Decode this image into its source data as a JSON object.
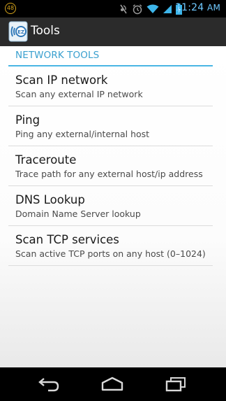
{
  "status_bar": {
    "notification_count": "48",
    "time": "11:24",
    "ampm": "AM",
    "clock_color": "#6fc9ff"
  },
  "action_bar": {
    "title": "Tools",
    "icon": "network-tools-app-icon"
  },
  "section": {
    "header": "NETWORK TOOLS",
    "accent_color": "#4ab6e4"
  },
  "items": [
    {
      "title": "Scan IP network",
      "subtitle": "Scan any external IP network"
    },
    {
      "title": "Ping",
      "subtitle": "Ping any external/internal host"
    },
    {
      "title": "Traceroute",
      "subtitle": "Trace path for any external host/ip address"
    },
    {
      "title": "DNS Lookup",
      "subtitle": "Domain Name Server lookup"
    },
    {
      "title": "Scan TCP services",
      "subtitle": "Scan active TCP ports on any host (0–1024)"
    }
  ],
  "nav_bar": {
    "back": "back-icon",
    "home": "home-icon",
    "recents": "recent-apps-icon"
  }
}
